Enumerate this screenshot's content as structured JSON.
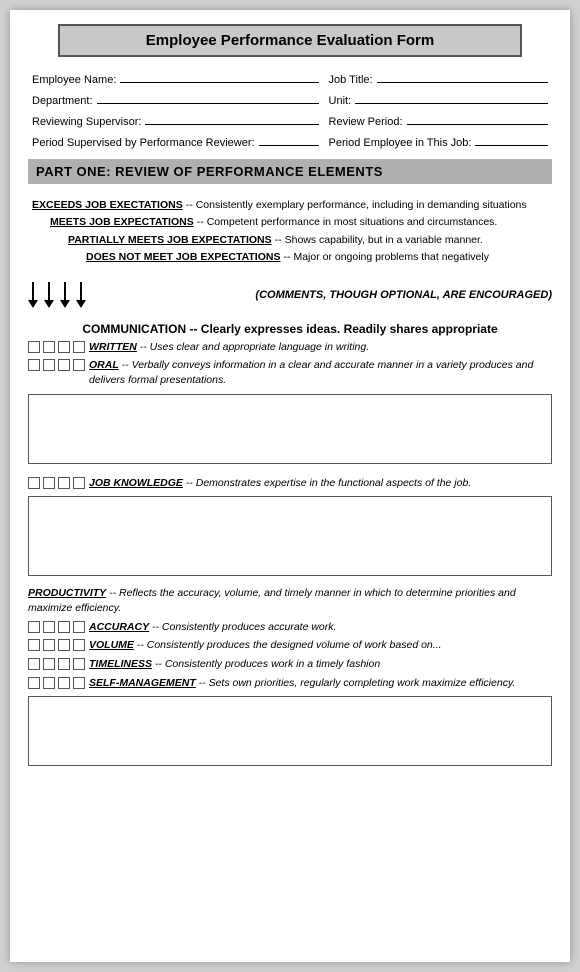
{
  "title": "Employee Performance Evaluation Form",
  "fields": {
    "employee_name_label": "Employee Name:",
    "job_title_label": "Job Title:",
    "department_label": "Department:",
    "unit_label": "Unit:",
    "reviewing_supervisor_label": "Reviewing Supervisor:",
    "review_period_label": "Review Period:",
    "period_supervised_label": "Period Supervised by Performance Reviewer:",
    "period_employee_label": "Period Employee in This Job:"
  },
  "part_one": {
    "header": "PART ONE: REVIEW OF PERFORMANCE ELEMENTS",
    "legend": [
      {
        "level": "level1",
        "bold": "EXCEEDS JOB EXECTATIONS",
        "text": " -- Consistently exemplary performance, including in demanding situations"
      },
      {
        "level": "level2",
        "bold": "MEETS JOB EXPECTATIONS",
        "text": " -- Competent performance in most situations and circumstances."
      },
      {
        "level": "level3",
        "bold": "PARTIALLY MEETS JOB EXPECTATIONS",
        "text": " -- Shows capability, but in a variable manner."
      },
      {
        "level": "level4",
        "bold": "DOES NOT MEET JOB EXPECTATIONS",
        "text": " -- Major or ongoing problems that negatively"
      }
    ],
    "comments_note": "(COMMENTS, THOUGH OPTIONAL, ARE ENCOURAGED)",
    "communication": {
      "title": "COMMUNICATION -- Clearly expresses ideas. Readily shares appropriate",
      "items": [
        {
          "bold": "WRITTEN",
          "text": " -- Uses clear and appropriate language in writing."
        },
        {
          "bold": "ORAL",
          "text": " -- Verbally conveys information in a clear and accurate manner in a variety produces and delivers formal presentations."
        }
      ]
    },
    "job_knowledge": {
      "title_bold": "JOB KNOWLEDGE",
      "title_text": " -- Demonstrates expertise in the functional aspects of the job."
    },
    "productivity": {
      "title_bold": "PRODUCTIVITY",
      "title_text": " -- Reflects the accuracy, volume, and timely manner in which to determine priorities and maximize efficiency.",
      "items": [
        {
          "bold": "ACCURACY",
          "text": " -- Consistently produces accurate work."
        },
        {
          "bold": "VOLUME",
          "text": " -- Consistently produces the designed volume of work based on..."
        },
        {
          "bold": "TIMELINESS",
          "text": " -- Consistently produces work in a timely fashion"
        },
        {
          "bold": "SELF-MANAGEMENT",
          "text": " -- Sets own priorities, regularly completing work maximize efficiency."
        }
      ]
    }
  }
}
